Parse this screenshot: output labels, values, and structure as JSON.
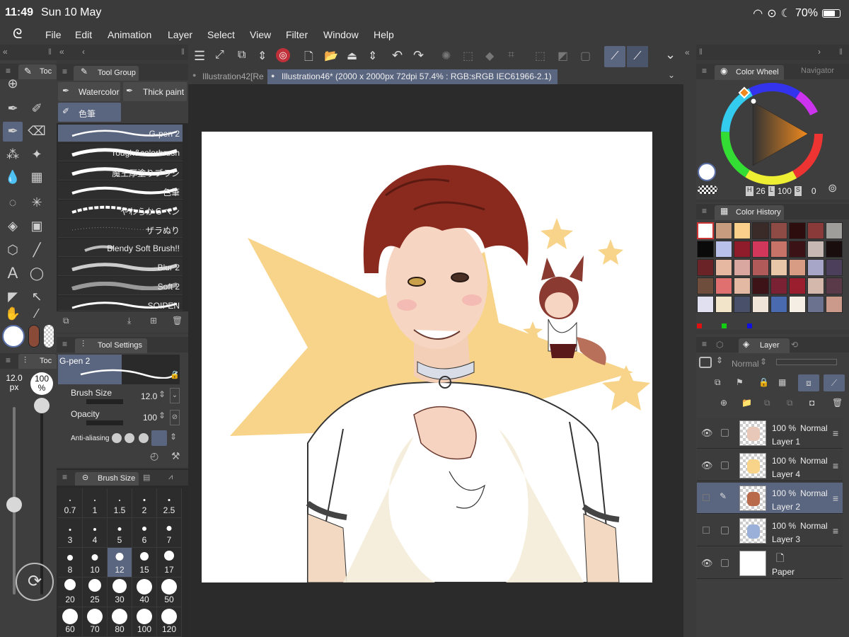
{
  "status": {
    "time": "11:49",
    "date": "Sun 10 May",
    "battery": "70%"
  },
  "menu": [
    "File",
    "Edit",
    "Animation",
    "Layer",
    "Select",
    "View",
    "Filter",
    "Window",
    "Help"
  ],
  "tools_panel": {
    "tab": "Toc"
  },
  "tool_group": {
    "title": "Tool Group",
    "tabs": [
      "Watercolor",
      "Thick paint",
      "色筆"
    ],
    "brushes": [
      "G-pen 2",
      "rough&colorbrush",
      "魔王厚塗りブラシ",
      "色筆",
      "やわらかＧペン",
      "ザラぬり",
      "Blendy Soft Brush!!",
      "Blur 2",
      "Soft 2",
      "SOIPEN"
    ]
  },
  "tool_settings": {
    "title": "Tool Settings",
    "side_tab": "Toc",
    "brush_name": "G-pen 2",
    "brush_size_label": "Brush Size",
    "brush_size_value": "12.0",
    "opacity_label": "Opacity",
    "opacity_value": "100",
    "anti_aliasing_label": "Anti-aliasing"
  },
  "size_slider": {
    "size_value": "12.0",
    "size_unit": "px",
    "opacity_value": "100",
    "opacity_unit": "%"
  },
  "brush_size_panel": {
    "title": "Brush Size",
    "sizes": [
      "0.7",
      "1",
      "1.5",
      "2",
      "2.5",
      "3",
      "4",
      "5",
      "6",
      "7",
      "8",
      "10",
      "12",
      "15",
      "17",
      "20",
      "25",
      "30",
      "40",
      "50",
      "60",
      "70",
      "80",
      "100",
      "120"
    ],
    "selected": "12"
  },
  "document_tabs": [
    {
      "label": "Illustration42[Re",
      "active": false
    },
    {
      "label": "Illustration46* (2000 x 2000px 72dpi 57.4% : RGB:sRGB IEC61966-2.1)",
      "active": true
    }
  ],
  "color_wheel": {
    "title": "Color Wheel",
    "nav_tab": "Navigator",
    "h_label": "H",
    "h_value": "26",
    "l_label": "L",
    "l_value": "100",
    "s_label": "S",
    "s_value": "0",
    "hue_color": "#f08a1e"
  },
  "color_history": {
    "title": "Color History",
    "swatches": [
      "#ffffff",
      "#c79c7f",
      "#fad08a",
      "#3a2a28",
      "#8e4b45",
      "#2e0d0e",
      "#8a3a38",
      "#a09e9a",
      "#0a0a0a",
      "#b9c0e9",
      "#8e1c2a",
      "#d1365b",
      "#c87368",
      "#3b1216",
      "#c8b8b4",
      "#1a0d0e",
      "#6a2326",
      "#e6b8a2",
      "#d9a7a0",
      "#b05a5a",
      "#e8c7a8",
      "#d89c84",
      "#a8a6c8",
      "#4b3f5c",
      "#6e4d3c",
      "#e07070",
      "#e3b9a4",
      "#3e1318",
      "#7a2233",
      "#9a1e2e",
      "#d4b8ac",
      "#5a3a48",
      "#e0e0f0",
      "#f2e4c8",
      "#48506a",
      "#f0e4d8",
      "#4a6ab0",
      "#f4eee4",
      "#6a7290",
      "#cc9a8a"
    ]
  },
  "layer_panel": {
    "title": "Layer",
    "blend_mode": "Normal",
    "layers": [
      {
        "opacity": "100 %",
        "mode": "Normal",
        "name": "Layer 1",
        "visible": true,
        "selected": false
      },
      {
        "opacity": "100 %",
        "mode": "Normal",
        "name": "Layer 4",
        "visible": true,
        "selected": false
      },
      {
        "opacity": "100 %",
        "mode": "Normal",
        "name": "Layer 2",
        "visible": false,
        "selected": true
      },
      {
        "opacity": "100 %",
        "mode": "Normal",
        "name": "Layer 3",
        "visible": false,
        "selected": false
      },
      {
        "name": "Paper",
        "visible": true,
        "selected": false
      }
    ]
  },
  "colors": {
    "accent": "#5a6680",
    "canvas_bg": "#2b2b2b",
    "star": "#f8d48a",
    "hair": "#8a2a1e"
  }
}
